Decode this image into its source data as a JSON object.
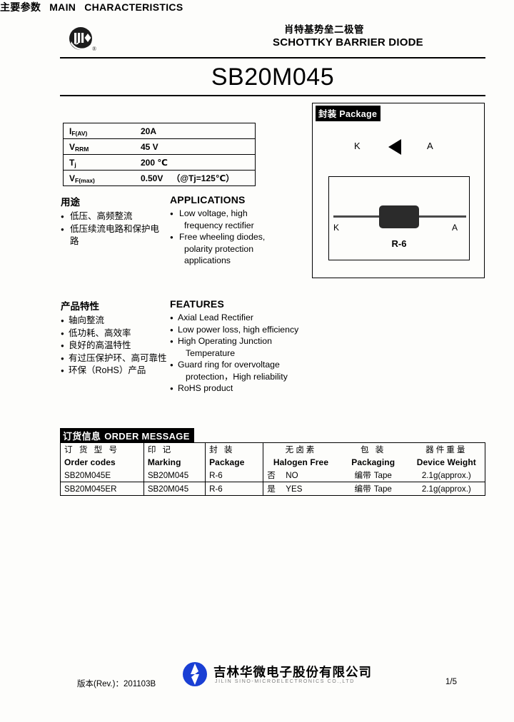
{
  "header": {
    "logo_icon": "jcc-circular-logo",
    "title_cn": "肖特基势垒二极管",
    "title_en": "SCHOTTKY BARRIER DIODE",
    "part_number": "SB20M045"
  },
  "main_characteristics": {
    "heading_cn": "主要参数",
    "heading_en_1": "MAIN",
    "heading_en_2": "CHARACTERISTICS",
    "rows": [
      {
        "symbol": "I",
        "subscript": "F(AV)",
        "value": "20A",
        "condition": ""
      },
      {
        "symbol": "V",
        "subscript": "RRM",
        "value": "45 V",
        "condition": ""
      },
      {
        "symbol": "T",
        "subscript": "j",
        "value": "200 ℃",
        "condition": ""
      },
      {
        "symbol": "V",
        "subscript": "F(max)",
        "value": "0.50V",
        "condition": "（@Tj=125℃）"
      }
    ]
  },
  "applications": {
    "title_cn": "用途",
    "title_en": "APPLICATIONS",
    "items_cn": [
      "低压、高频整流",
      "低压续流电路和保护电",
      "路"
    ],
    "items_en": [
      "Low voltage, high",
      "frequency rectifier",
      "Free wheeling diodes,",
      "polarity protection",
      "applications"
    ]
  },
  "features": {
    "title_cn": "产品特性",
    "title_en": "FEATURES",
    "items_cn": [
      "轴向整流",
      "低功耗、高效率",
      "良好的高温特性",
      "有过压保护环、高可靠性",
      "环保（RoHS）产品"
    ],
    "items_en": [
      "Axial Lead Rectifier",
      "Low power loss, high efficiency",
      "High Operating Junction",
      "Temperature",
      "Guard ring for overvoltage",
      "protection，High reliability",
      "RoHS product"
    ]
  },
  "package": {
    "label_cn": "封装",
    "label_en": "Package",
    "symbol_cathode": "K",
    "symbol_anode": "A",
    "photo_cathode": "K",
    "photo_anode": "A",
    "package_code": "R-6",
    "diode_icon": "diode-triangle-icon",
    "photo_icon": "axial-diode-photo"
  },
  "order_message": {
    "heading_cn": "订货信息",
    "heading_en": "ORDER MESSAGE",
    "columns": [
      {
        "cn": "订 货 型 号",
        "en": "Order codes"
      },
      {
        "cn": "印    记",
        "en": "Marking"
      },
      {
        "cn": "封    装",
        "en": "Package"
      },
      {
        "cn": "无卤素",
        "en": "Halogen Free"
      },
      {
        "cn": "包    装",
        "en": "Packaging"
      },
      {
        "cn": "器件重量",
        "en": "Device Weight"
      }
    ],
    "rows": [
      {
        "order_code": "SB20M045E",
        "marking": "SB20M045",
        "package": "R-6",
        "halogen_free_cn": "否",
        "halogen_free_en": "NO",
        "packaging_cn": "编带",
        "packaging_en": "Tape",
        "device_weight": "2.1g(approx.)"
      },
      {
        "order_code": "SB20M045ER",
        "marking": "SB20M045",
        "package": "R-6",
        "halogen_free_cn": "是",
        "halogen_free_en": "YES",
        "packaging_cn": "编带",
        "packaging_en": "Tape",
        "device_weight": "2.1g(approx.)"
      }
    ]
  },
  "footer": {
    "revision": "版本(Rev.)：201103B",
    "company_cn": "吉林华微电子股份有限公司",
    "company_en": "JILIN SINO-MICROELECTRONICS CO.,LTD",
    "page_number": "1/5",
    "logo_icon": "sino-micro-logo",
    "logo_color": "#1a3fd4"
  }
}
